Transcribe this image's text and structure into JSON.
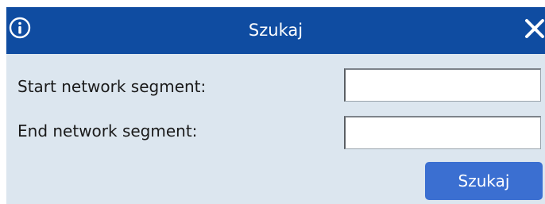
{
  "dialog": {
    "title": "Szukaj",
    "info_icon": "info-circle-icon",
    "close_icon": "close-x-icon"
  },
  "form": {
    "start_label": "Start network segment:",
    "start_value": "",
    "end_label": "End network segment:",
    "end_value": "",
    "submit_label": "Szukaj"
  },
  "colors": {
    "titlebar": "#0f4ca1",
    "body": "#dce6ef",
    "button": "#3b6fd1",
    "title_text": "#ffffff"
  }
}
